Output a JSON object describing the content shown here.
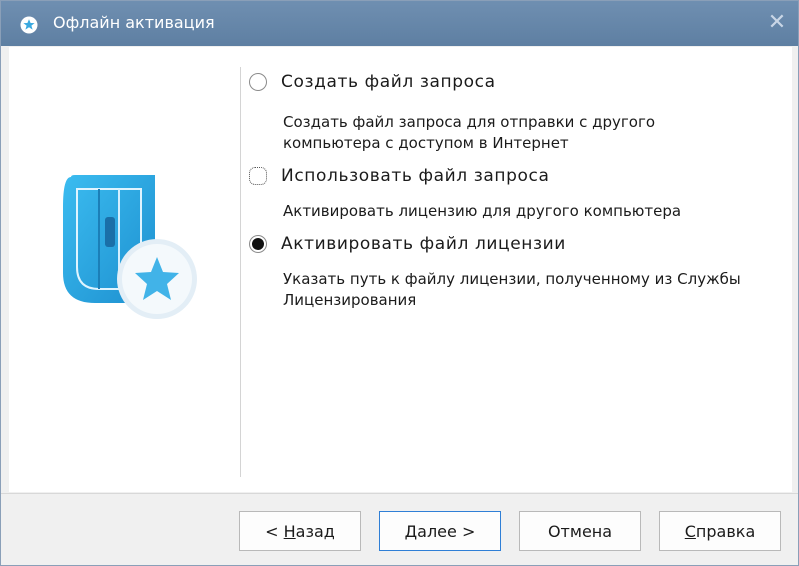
{
  "window": {
    "title": "Офлайн активация",
    "close_glyph": "✕"
  },
  "options": [
    {
      "label": "Создать файл запроса",
      "description": "Создать файл запроса для отправки с другого компьютера с доступом в Интернет",
      "checked": false
    },
    {
      "label": "Использовать файл запроса",
      "description": "Активировать лицензию для другого компьютера",
      "checked": false
    },
    {
      "label": "Активировать файл лицензии",
      "description": "Указать путь к файлу лицензии, полученному из Службы Лицензирования",
      "checked": true
    }
  ],
  "buttons": {
    "back": {
      "prefix": "< ",
      "mnemonic": "Н",
      "rest": "азад"
    },
    "next": {
      "mnemonic": "Д",
      "rest": "алее >"
    },
    "cancel": {
      "label": "Отмена"
    },
    "help": {
      "mnemonic": "С",
      "rest": "правка"
    }
  },
  "colors": {
    "titlebar": "#6488ad",
    "logo_blue": "#2aa8e0",
    "star_blue": "#3fb2e8",
    "default_button_border": "#2f7fd6"
  },
  "icons": {
    "app": "star-badge-icon",
    "close": "close-icon",
    "logo": "product-logo-icon"
  }
}
